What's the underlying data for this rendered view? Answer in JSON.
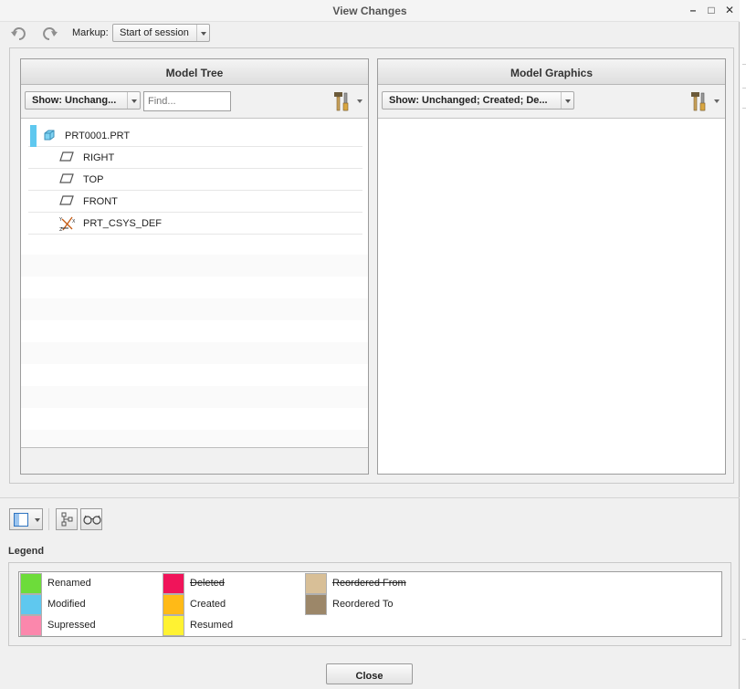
{
  "window": {
    "title": "View Changes",
    "minimize_glyph": "–",
    "maximize_glyph": "□",
    "close_glyph": "✕"
  },
  "toolbar": {
    "undo_icon": "undo-icon",
    "redo_icon": "redo-icon",
    "markup_label": "Markup:",
    "markup_value": "Start of session"
  },
  "model_tree": {
    "title": "Model Tree",
    "show_filter": "Show: Unchang...",
    "find_placeholder": "Find...",
    "items": [
      {
        "label": "PRT0001.PRT",
        "icon": "part-icon",
        "status_color": "#5fc8ef"
      },
      {
        "label": "RIGHT",
        "icon": "datum-plane-icon"
      },
      {
        "label": "TOP",
        "icon": "datum-plane-icon"
      },
      {
        "label": "FRONT",
        "icon": "datum-plane-icon"
      },
      {
        "label": "PRT_CSYS_DEF",
        "icon": "coordinate-system-icon"
      }
    ]
  },
  "model_graphics": {
    "title": "Model Graphics",
    "show_filter": "Show: Unchanged; Created; De..."
  },
  "legend": {
    "title": "Legend",
    "items": [
      {
        "label": "Renamed",
        "color": "#6ddc3a",
        "strike": false
      },
      {
        "label": "Modified",
        "color": "#5fc8ef",
        "strike": false
      },
      {
        "label": "Supressed",
        "color": "#fb87ac",
        "strike": false
      },
      {
        "label": "Deleted",
        "color": "#f0145a",
        "strike": true
      },
      {
        "label": "Created",
        "color": "#ffba17",
        "strike": false
      },
      {
        "label": "Resumed",
        "color": "#fff232",
        "strike": false
      },
      {
        "label": "Reordered From",
        "color": "#d8bf97",
        "strike": true
      },
      {
        "label": "Reordered To",
        "color": "#9c8769",
        "strike": false
      }
    ]
  },
  "footer": {
    "close_label": "Close"
  }
}
